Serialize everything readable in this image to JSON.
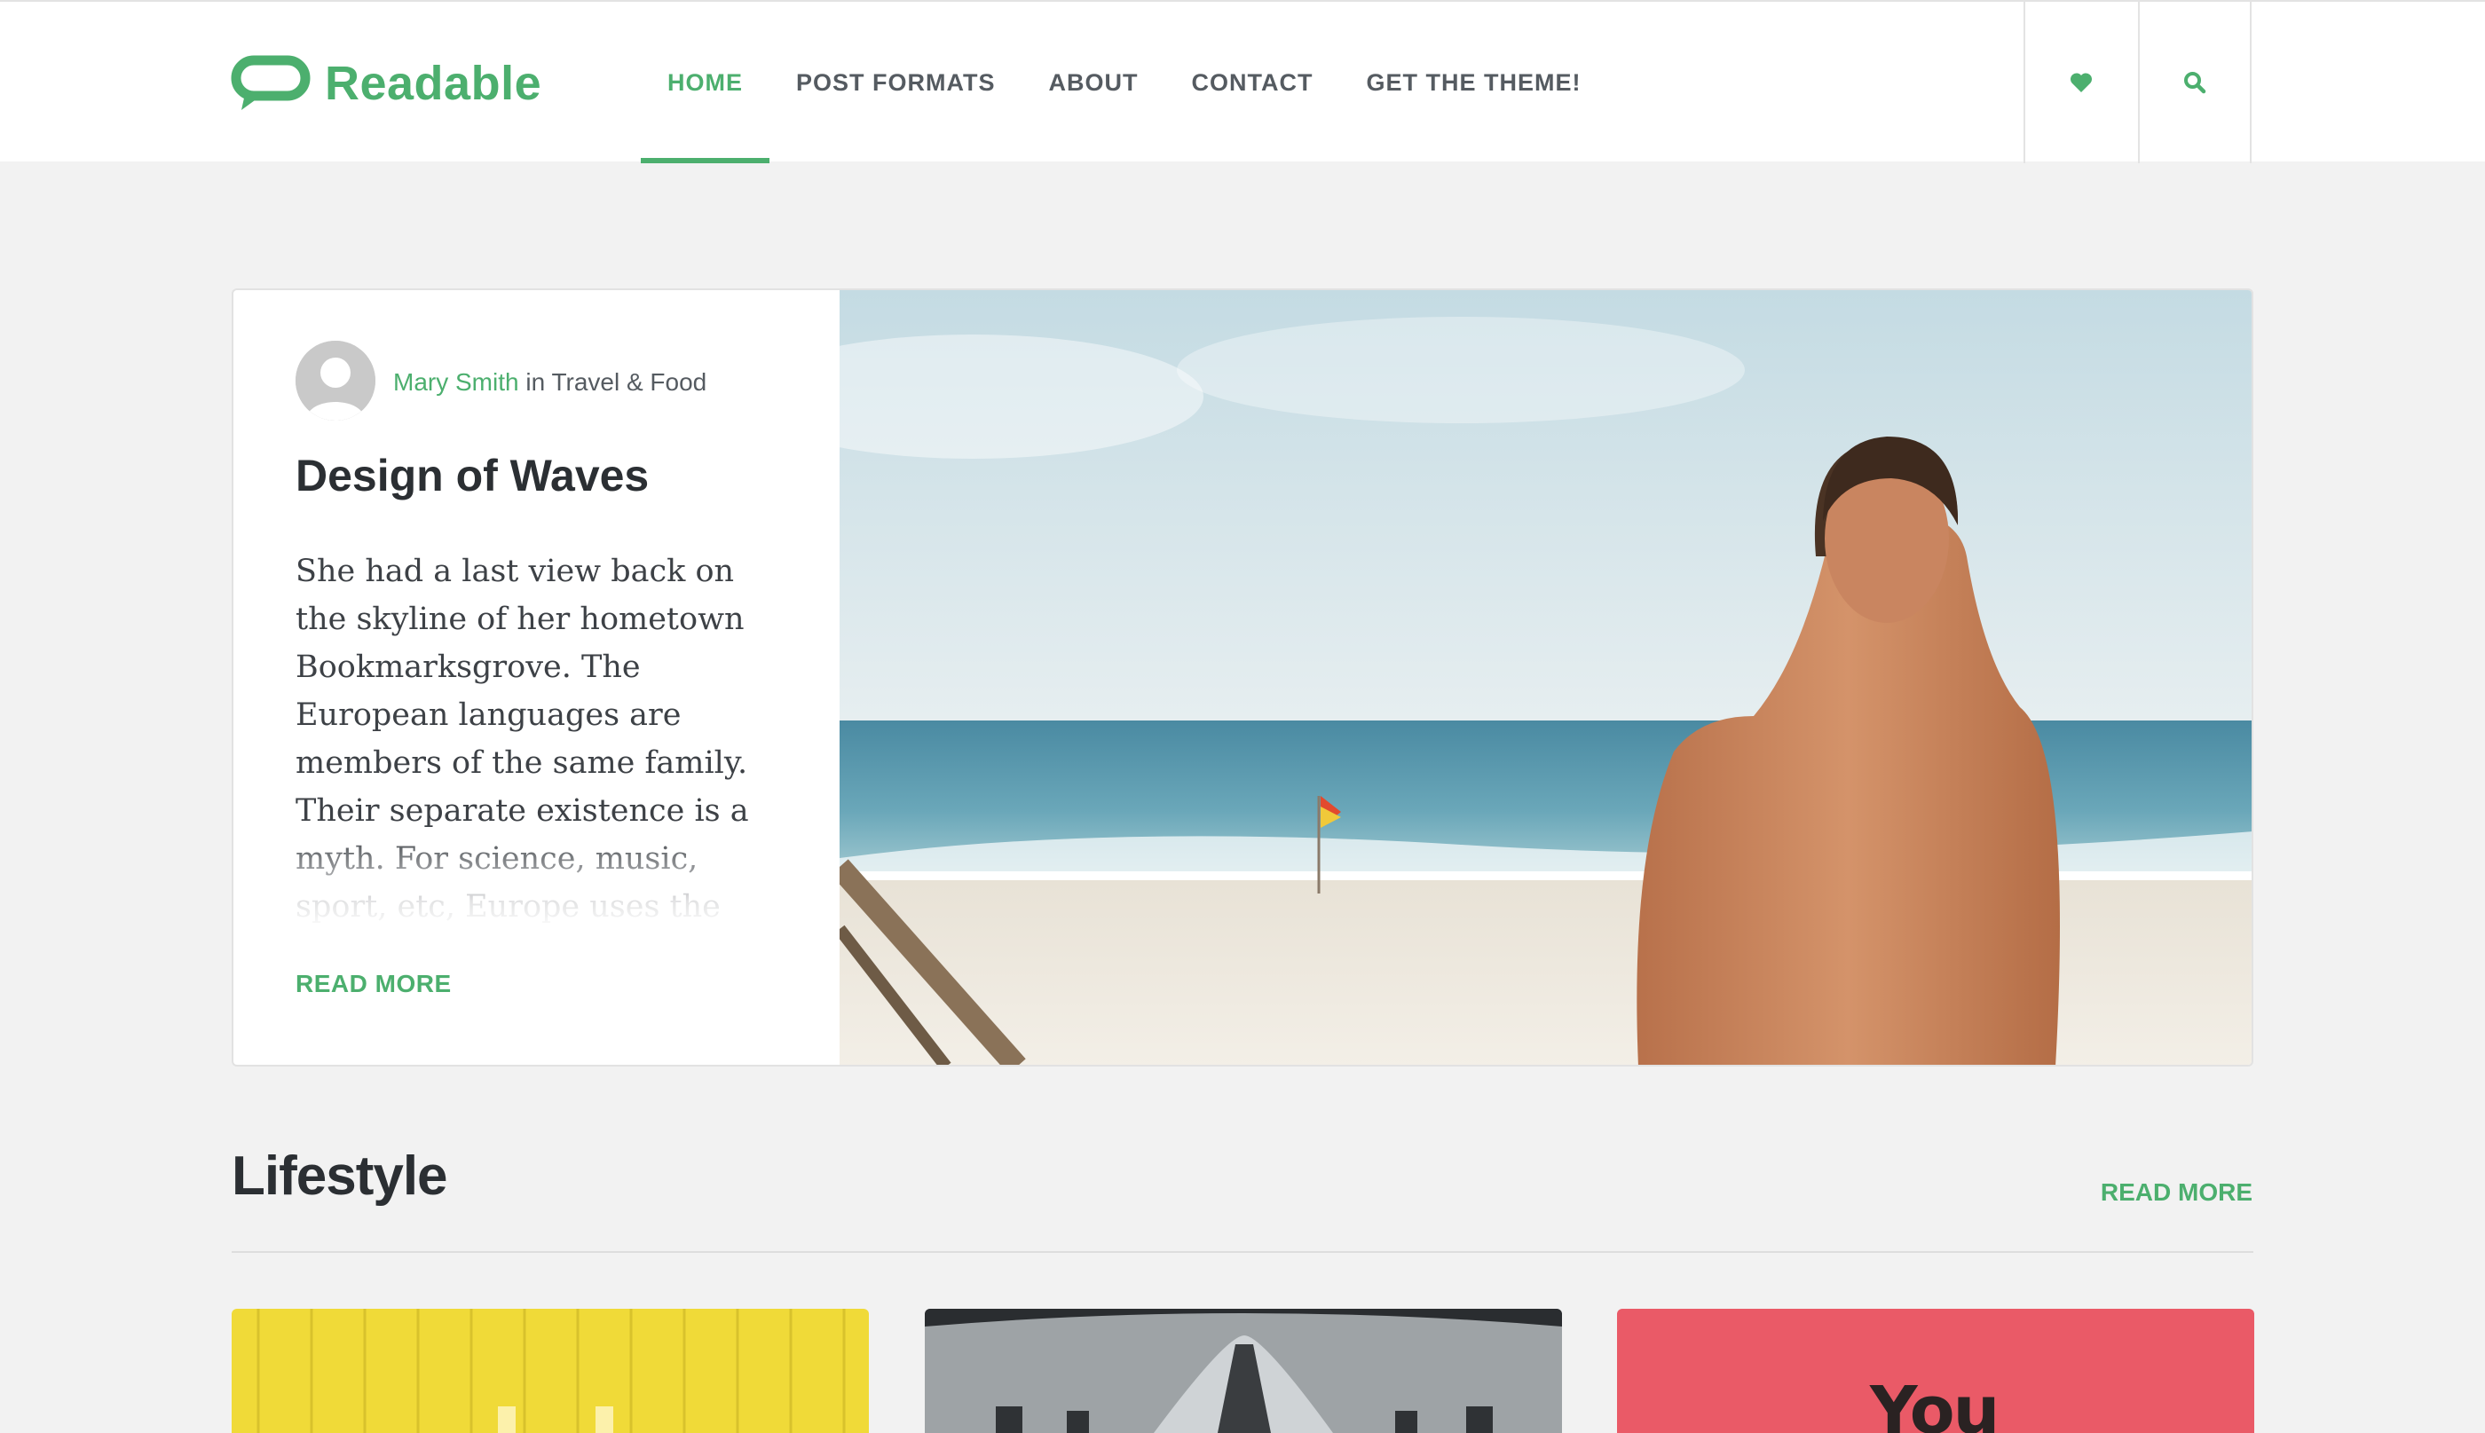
{
  "brand": {
    "name": "Readable",
    "accent": "#4caf6e"
  },
  "nav": {
    "items": [
      {
        "label": "HOME",
        "active": true
      },
      {
        "label": "POST FORMATS",
        "active": false
      },
      {
        "label": "ABOUT",
        "active": false
      },
      {
        "label": "CONTACT",
        "active": false
      },
      {
        "label": "GET THE THEME!",
        "active": false
      }
    ],
    "icons": [
      "heart-icon",
      "search-icon"
    ]
  },
  "featured": {
    "author": "Mary Smith",
    "category_prefix": " in ",
    "category": "Travel & Food",
    "title": "Design of Waves",
    "excerpt": "She had a last view back on the skyline of her hometown Bookmarksgrove. The European languages are members of the same family. Their separate existence is a myth. For science, music, sport, etc, Europe uses the same vocabulary. The languages",
    "read_more": "READ MORE"
  },
  "lifestyle": {
    "title": "Lifestyle",
    "read_more": "READ MORE",
    "tiles": [
      {
        "color": "#f2dc3c"
      },
      {
        "color": "#b8bcbf"
      },
      {
        "color": "#ec5a68",
        "text": "You"
      }
    ]
  }
}
